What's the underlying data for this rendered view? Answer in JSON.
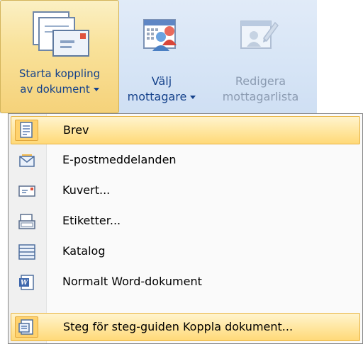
{
  "ribbon": {
    "start_merge": {
      "line1": "Starta koppling",
      "line2": "av dokument"
    },
    "select_recipients": {
      "line1": "Välj",
      "line2": "mottagare"
    },
    "edit_recipient_list": {
      "line1": "Redigera",
      "line2": "mottagarlista"
    }
  },
  "menu": {
    "items": [
      {
        "label": "Brev",
        "icon": "letter-icon",
        "selected": true
      },
      {
        "label": "E-postmeddelanden",
        "icon": "email-icon",
        "selected": false
      },
      {
        "label": "Kuvert...",
        "icon": "envelope-icon",
        "selected": false
      },
      {
        "label": "Etiketter...",
        "icon": "labels-icon",
        "selected": false
      },
      {
        "label": "Katalog",
        "icon": "directory-icon",
        "selected": false
      },
      {
        "label": "Normalt Word-dokument",
        "icon": "word-document-icon",
        "selected": false
      },
      {
        "label": "Steg för steg-guiden Koppla dokument...",
        "icon": "wizard-icon",
        "selected": true
      }
    ]
  },
  "colors": {
    "ribbon_bg": "#dbe7f6",
    "ribbon_text": "#15428b",
    "disabled_text": "#8b9bb1",
    "highlight": "#ffe7a2",
    "menu_bg": "#fafafa"
  }
}
